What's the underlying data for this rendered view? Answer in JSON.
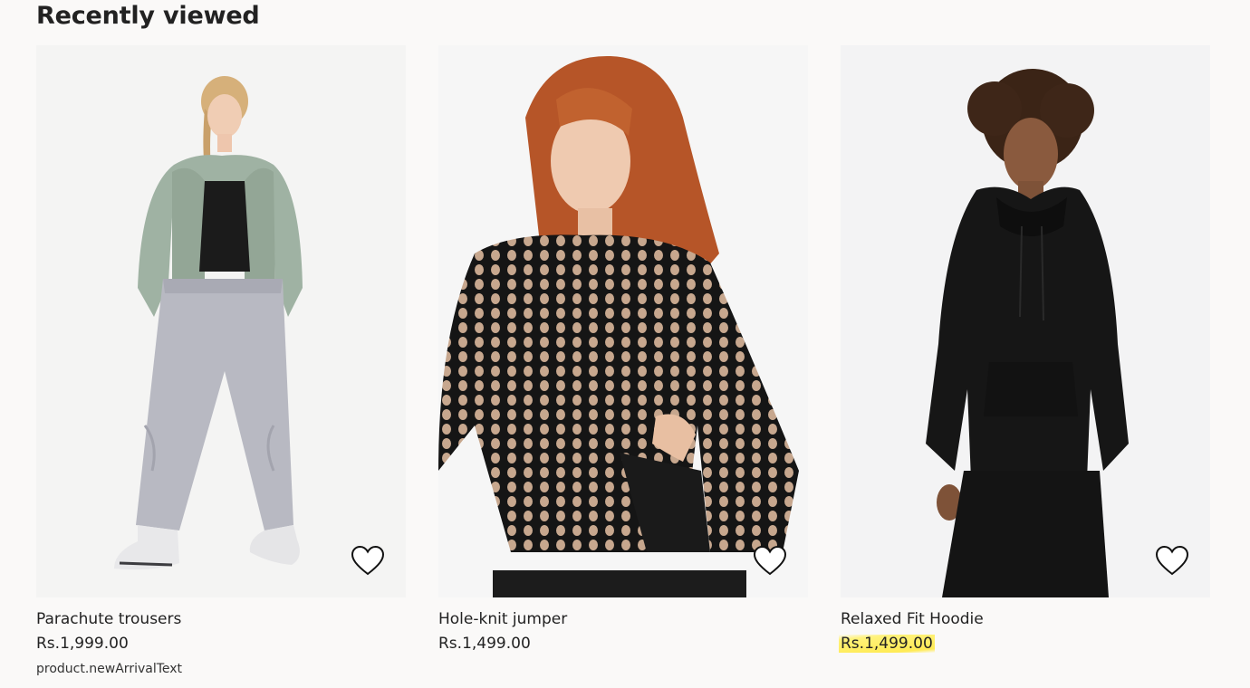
{
  "section": {
    "title": "Recently viewed"
  },
  "products": [
    {
      "name": "Parachute trousers",
      "price": "Rs.1,999.00",
      "badge": "product.newArrivalText"
    },
    {
      "name": "Hole-knit jumper",
      "price": "Rs.1,499.00"
    },
    {
      "name": "Relaxed Fit Hoodie",
      "price": "Rs.1,499.00"
    }
  ],
  "colors": {
    "background": "#faf9f8",
    "text": "#222222",
    "highlight": "#ffeb55"
  },
  "icons": {
    "favourite": "heart-outline-icon"
  }
}
